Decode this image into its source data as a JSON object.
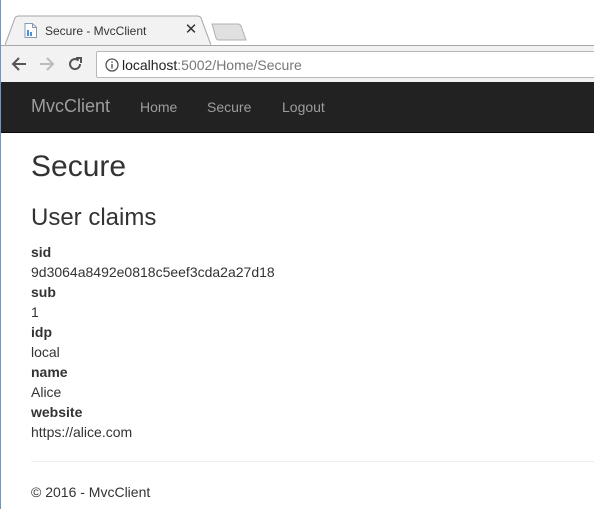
{
  "browser": {
    "tab_title": "Secure - MvcClient",
    "url_host": "localhost",
    "url_rest": ":5002/Home/Secure"
  },
  "navbar": {
    "brand": "MvcClient",
    "links": [
      "Home",
      "Secure",
      "Logout"
    ]
  },
  "page": {
    "title": "Secure",
    "section_title": "User claims"
  },
  "claims": [
    {
      "type": "sid",
      "value": "9d3064a8492e0818c5eef3cda2a27d18"
    },
    {
      "type": "sub",
      "value": "1"
    },
    {
      "type": "idp",
      "value": "local"
    },
    {
      "type": "name",
      "value": "Alice"
    },
    {
      "type": "website",
      "value": "https://alice.com"
    }
  ],
  "footer": {
    "text": "© 2016 - MvcClient"
  },
  "icons": {
    "tab_favicon": "page-icon",
    "tab_close": "close-icon",
    "back": "back-arrow-icon",
    "forward": "forward-arrow-icon",
    "reload": "reload-icon",
    "site_info": "info-icon"
  }
}
